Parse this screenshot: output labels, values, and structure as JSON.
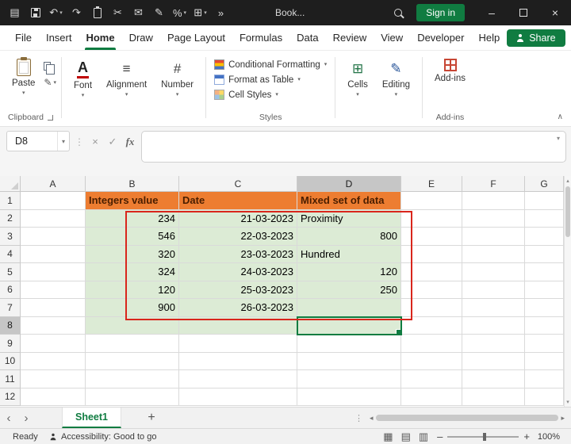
{
  "titlebar": {
    "title": "Book...",
    "sign_in_label": "Sign in",
    "qat": [
      {
        "name": "app-launcher-icon",
        "glyph": "▤"
      },
      {
        "name": "save-icon",
        "shape": "i-floppy"
      },
      {
        "name": "undo-icon",
        "glyph": "↶",
        "caret": true
      },
      {
        "name": "redo-icon",
        "glyph": "↷"
      },
      {
        "name": "clipboard-icon",
        "shape": "i-clip"
      },
      {
        "name": "cut-icon",
        "glyph": "✂"
      },
      {
        "name": "mail-icon",
        "glyph": "✉"
      },
      {
        "name": "format-painter-icon",
        "glyph": "✎"
      },
      {
        "name": "percent-style-icon",
        "glyph": "%",
        "caret": true
      },
      {
        "name": "borders-icon",
        "glyph": "⊞",
        "caret": true
      },
      {
        "name": "overflow-icon",
        "glyph": "»"
      }
    ]
  },
  "menubar": {
    "tabs": [
      "File",
      "Insert",
      "Home",
      "Draw",
      "Page Layout",
      "Formulas",
      "Data",
      "Review",
      "View",
      "Developer",
      "Help"
    ],
    "active_tab": "Home",
    "share_label": "Share"
  },
  "ribbon": {
    "paste_label": "Paste",
    "clipboard_group_label": "Clipboard",
    "font_label": "Font",
    "alignment_label": "Alignment",
    "number_label": "Number",
    "conditional_formatting_label": "Conditional Formatting",
    "format_as_table_label": "Format as Table",
    "cell_styles_label": "Cell Styles",
    "styles_group_label": "Styles",
    "cells_label": "Cells",
    "editing_label": "Editing",
    "addins_label": "Add-ins",
    "addins_group_label": "Add-ins"
  },
  "formula_bar": {
    "name_box": "D8",
    "fx_label": "fx"
  },
  "spreadsheet": {
    "columns": [
      "A",
      "B",
      "C",
      "D",
      "E",
      "F",
      "G"
    ],
    "rows": [
      1,
      2,
      3,
      4,
      5,
      6,
      7,
      8,
      9,
      10,
      11,
      12
    ],
    "active_cell": "D8",
    "active_col": "D",
    "active_row": 8,
    "fill_cols": [
      "B",
      "C",
      "D"
    ],
    "fill_rows": [
      2,
      3,
      4,
      5,
      6,
      7,
      8
    ],
    "cells": {
      "B1": {
        "v": "Integers value",
        "s": "orange"
      },
      "C1": {
        "v": "Date",
        "s": "orange"
      },
      "D1": {
        "v": "Mixed set of data",
        "s": "orange"
      },
      "B2": {
        "v": "234",
        "a": "r"
      },
      "C2": {
        "v": "21-03-2023",
        "a": "r"
      },
      "D2": {
        "v": "Proximity",
        "a": "l"
      },
      "B3": {
        "v": "546",
        "a": "r"
      },
      "C3": {
        "v": "22-03-2023",
        "a": "r"
      },
      "D3": {
        "v": "800",
        "a": "r"
      },
      "B4": {
        "v": "320",
        "a": "r"
      },
      "C4": {
        "v": "23-03-2023",
        "a": "r"
      },
      "D4": {
        "v": "Hundred",
        "a": "l"
      },
      "B5": {
        "v": "324",
        "a": "r"
      },
      "C5": {
        "v": "24-03-2023",
        "a": "r"
      },
      "D5": {
        "v": "120",
        "a": "r"
      },
      "B6": {
        "v": "120",
        "a": "r"
      },
      "C6": {
        "v": "25-03-2023",
        "a": "r"
      },
      "D6": {
        "v": "250",
        "a": "r"
      },
      "B7": {
        "v": "900",
        "a": "r"
      },
      "C7": {
        "v": "26-03-2023",
        "a": "r"
      }
    }
  },
  "sheetbar": {
    "active_tab": "Sheet1",
    "add_label": "+"
  },
  "statusbar": {
    "mode": "Ready",
    "accessibility": "Accessibility: Good to go",
    "zoom": "100%"
  },
  "colors": {
    "accent_green": "#107C41",
    "header_orange": "#ED7D31",
    "header_text": "#4A1E00",
    "fill_green": "#DCEBD5",
    "annotation_red": "#D9261C",
    "titlebar_bg": "#1E1E1E"
  }
}
